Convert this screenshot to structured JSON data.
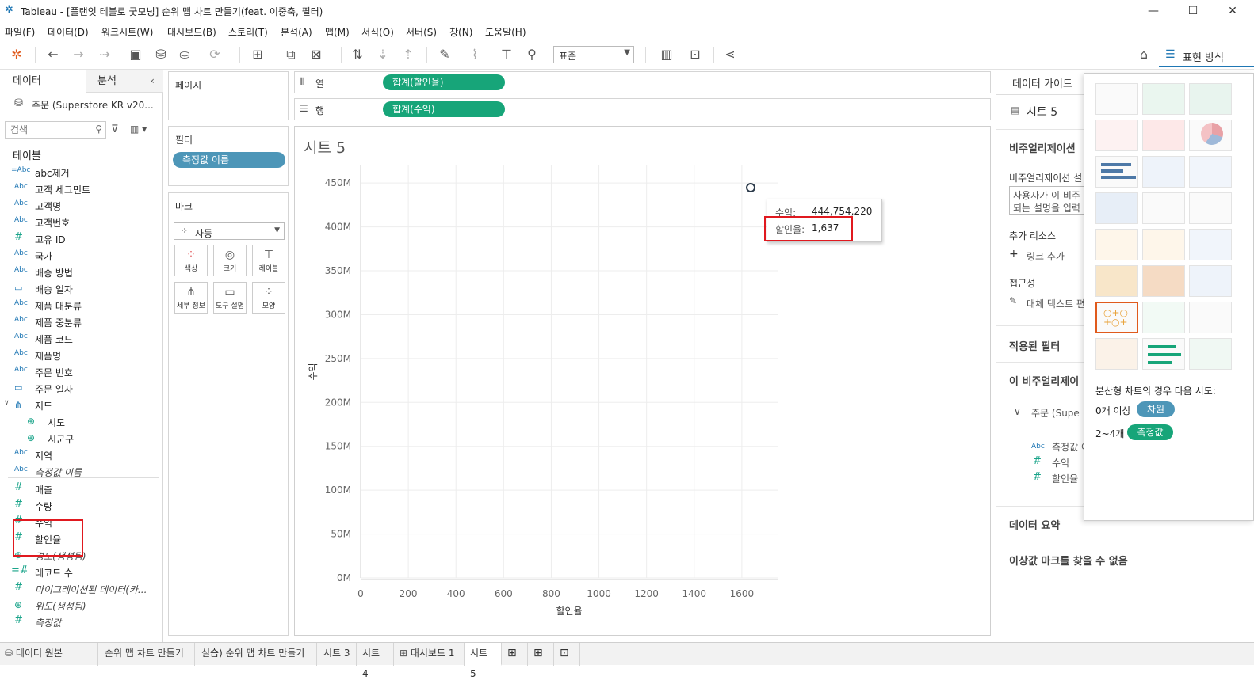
{
  "window": {
    "title": "Tableau - [플랜잇 테블로 굿모닝] 순위 맵 차트 만들기(feat. 이중축, 필터)"
  },
  "menu": [
    "파일(F)",
    "데이터(D)",
    "워크시트(W)",
    "대시보드(B)",
    "스토리(T)",
    "분석(A)",
    "맵(M)",
    "서식(O)",
    "서버(S)",
    "창(N)",
    "도움말(H)"
  ],
  "toolbar": {
    "fit_select": "표준",
    "show_me_label": "표현 방식"
  },
  "left_panel": {
    "tab_data": "데이터",
    "tab_analysis": "분석",
    "datasource": "주문 (Superstore KR v20...",
    "search_placeholder": "검색",
    "tables_heading": "테이블",
    "fields": [
      {
        "icon": "=Abc",
        "name": "abc제거"
      },
      {
        "icon": "Abc",
        "name": "고객 세그먼트"
      },
      {
        "icon": "Abc",
        "name": "고객명"
      },
      {
        "icon": "Abc",
        "name": "고객번호"
      },
      {
        "icon": "#",
        "name": "고유 ID"
      },
      {
        "icon": "Abc",
        "name": "국가"
      },
      {
        "icon": "Abc",
        "name": "배송 방법"
      },
      {
        "icon": "▭",
        "name": "배송 일자"
      },
      {
        "icon": "Abc",
        "name": "제품 대분류"
      },
      {
        "icon": "Abc",
        "name": "제품 중분류"
      },
      {
        "icon": "Abc",
        "name": "제품 코드"
      },
      {
        "icon": "Abc",
        "name": "제품명"
      },
      {
        "icon": "Abc",
        "name": "주문 번호"
      },
      {
        "icon": "▭",
        "name": "주문 일자"
      },
      {
        "icon": "⋔",
        "name": "지도"
      },
      {
        "icon": "⊕",
        "name": "시도"
      },
      {
        "icon": "⊕",
        "name": "시군구"
      },
      {
        "icon": "Abc",
        "name": "지역"
      },
      {
        "icon": "Abc",
        "name": "측정값 이름"
      },
      {
        "icon": "#",
        "name": "매출"
      },
      {
        "icon": "#",
        "name": "수량"
      },
      {
        "icon": "#",
        "name": "수익"
      },
      {
        "icon": "#",
        "name": "할인율"
      },
      {
        "icon": "⊕",
        "name": "경도(생성됨)"
      },
      {
        "icon": "=#",
        "name": "레코드 수"
      },
      {
        "icon": "#",
        "name": "마이그레이션된 데이터(카..."
      },
      {
        "icon": "⊕",
        "name": "위도(생성됨)"
      },
      {
        "icon": "#",
        "name": "측정값"
      }
    ]
  },
  "shelves": {
    "pages_label": "페이지",
    "filters_label": "필터",
    "filter_pill": "측정값 이름",
    "marks_label": "마크",
    "marks_type": "자동",
    "mark_buttons": [
      "색상",
      "크기",
      "레이블",
      "세부 정보",
      "도구 설명",
      "모양"
    ],
    "columns_label": "열",
    "columns_pill": "합계(할인율)",
    "rows_label": "행",
    "rows_pill": "합계(수익)"
  },
  "sheet": {
    "title": "시트 5"
  },
  "chart_data": {
    "type": "scatter",
    "x": [
      1637
    ],
    "y": [
      444754220
    ],
    "xlabel": "할인율",
    "ylabel": "수익",
    "xlim": [
      0,
      1750
    ],
    "ylim": [
      0,
      470000000
    ],
    "x_ticks": [
      "0",
      "200",
      "400",
      "600",
      "800",
      "1000",
      "1200",
      "1400",
      "1600"
    ],
    "y_ticks": [
      "0M",
      "50M",
      "100M",
      "150M",
      "200M",
      "250M",
      "300M",
      "350M",
      "400M",
      "450M"
    ],
    "grid": true
  },
  "tooltip": {
    "profit_label": "수익:",
    "profit_value": "444,754,220",
    "discount_label": "할인율:",
    "discount_value": "1,637"
  },
  "guide": {
    "tab": "데이터 가이드",
    "sheet_name": "시트 5",
    "viz_heading": "비주얼리제이션",
    "viz_desc_label": "비주얼리제이션 설",
    "viz_desc_placeholder1": "사용자가 이 비주",
    "viz_desc_placeholder2": "되는 설명을 입력",
    "resources": "추가 리소스",
    "add_link": "링크 추가",
    "accessibility": "접근성",
    "alt_text": "대체 텍스트 편",
    "applied_filters": "적용된 필터",
    "this_viz": "이 비주얼리제이",
    "ds": "주문 (Supe",
    "used_fields": [
      {
        "icon": "Abc",
        "name": "측정값 이"
      },
      {
        "icon": "#",
        "name": "수익"
      },
      {
        "icon": "#",
        "name": "할인율"
      }
    ],
    "data_summary": "데이터 요약",
    "outliers": "이상값 마크를 찾을 수 없음"
  },
  "show_me": {
    "hint": "분산형 차트의 경우 다음 시도:",
    "dim_count": "0개 이상",
    "dim_label": "차원",
    "measure_count": "2~4개",
    "measure_label": "측정값",
    "dim_color": "#4d96b8",
    "measure_color": "#17a579"
  },
  "tabs": [
    "데이터 원본",
    "순위 맵 차트 만들기",
    "실습) 순위 맵 차트 만들기",
    "시트 3",
    "시트 4",
    "대시보드 1",
    "시트 5"
  ]
}
